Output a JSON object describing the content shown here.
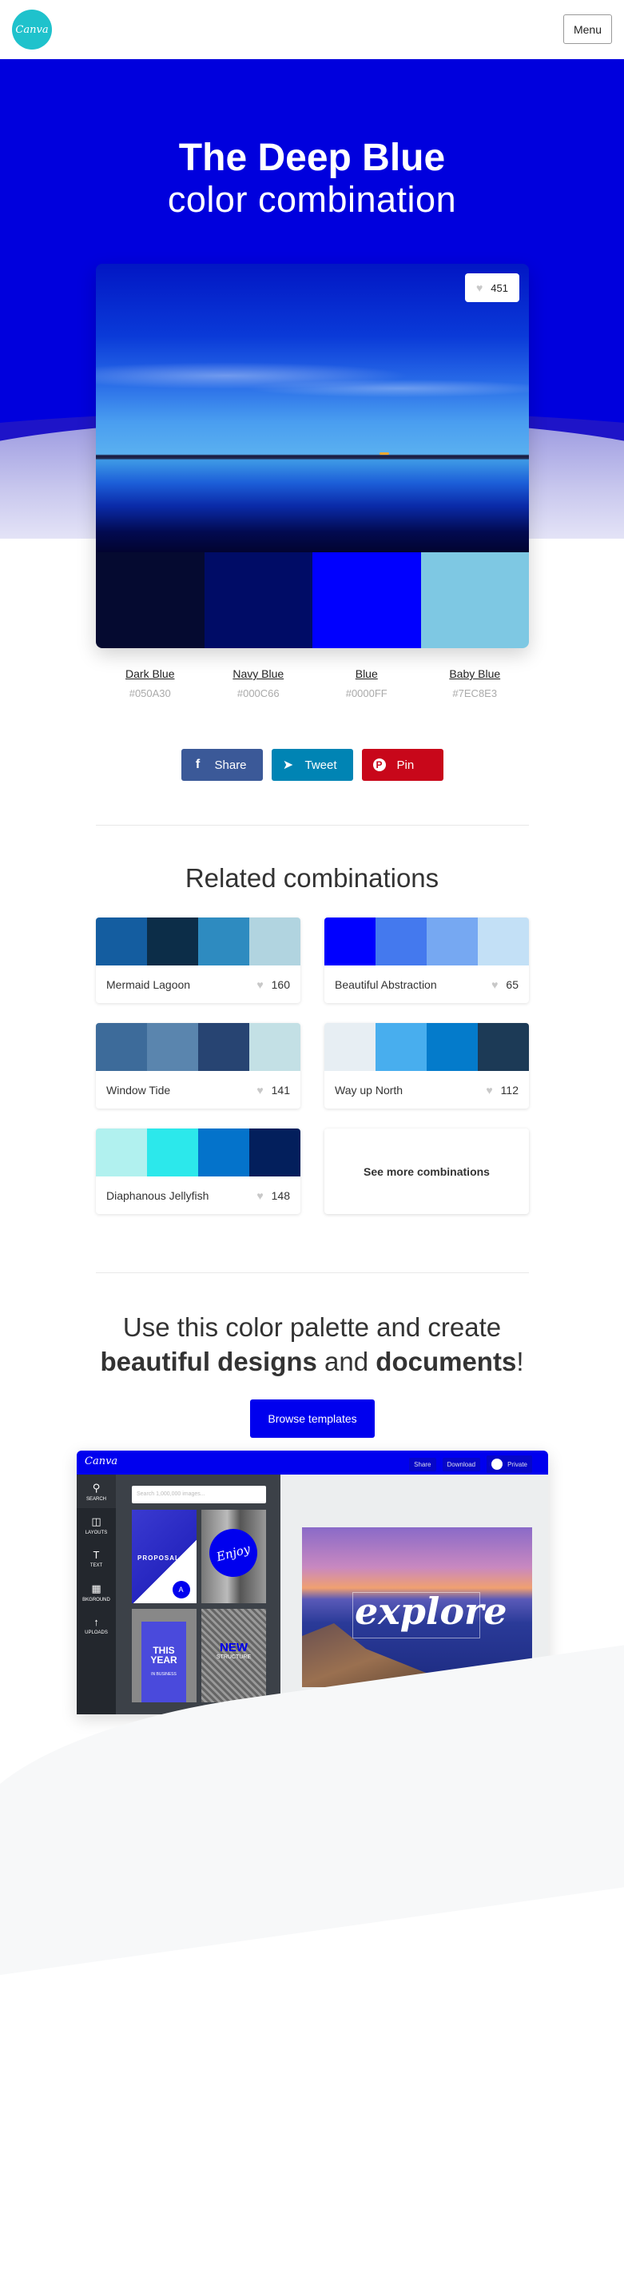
{
  "header": {
    "logo_text": "Canva",
    "menu_label": "Menu"
  },
  "hero": {
    "title": "The Deep Blue",
    "subtitle": "color combination",
    "likes": "451",
    "background_color": "#0000DD"
  },
  "palette": [
    {
      "name": "Dark Blue",
      "hex": "#050A30"
    },
    {
      "name": "Navy Blue",
      "hex": "#000C66"
    },
    {
      "name": "Blue",
      "hex": "#0000FF"
    },
    {
      "name": "Baby Blue",
      "hex": "#7EC8E3"
    }
  ],
  "share": {
    "facebook": {
      "label": "Share",
      "icon": "facebook-icon",
      "color": "#3B5998"
    },
    "twitter": {
      "label": "Tweet",
      "icon": "twitter-icon",
      "color": "#0084B4"
    },
    "pinterest": {
      "label": "Pin",
      "icon": "pinterest-icon",
      "color": "#C8071A"
    }
  },
  "related": {
    "title": "Related combinations",
    "items": [
      {
        "name": "Mermaid Lagoon",
        "likes": "160",
        "colors": [
          "#145DA0",
          "#0C2D48",
          "#2E8BC0",
          "#B1D4E0"
        ]
      },
      {
        "name": "Beautiful Abstraction",
        "likes": "65",
        "colors": [
          "#0000FF",
          "#4479EE",
          "#76A8F2",
          "#C3E0F6"
        ]
      },
      {
        "name": "Window Tide",
        "likes": "141",
        "colors": [
          "#3D6B9A",
          "#5A85AE",
          "#274472",
          "#C3E0E5"
        ]
      },
      {
        "name": "Way up North",
        "likes": "112",
        "colors": [
          "#E7EEF3",
          "#48AEEE",
          "#047BCB",
          "#1C3A56"
        ]
      },
      {
        "name": "Diaphanous Jellyfish",
        "likes": "148",
        "colors": [
          "#B1F1EF",
          "#2CE8EB",
          "#0473CB",
          "#031F5C"
        ]
      }
    ],
    "see_more_label": "See more combinations"
  },
  "cta": {
    "line1": "Use this color palette and create",
    "bold1": "beautiful designs",
    "mid": "and",
    "bold2": "documents",
    "end": "!",
    "button_label": "Browse templates",
    "button_color": "#0000EE"
  },
  "editor_preview": {
    "logo": "Canva",
    "actions": [
      "Share",
      "Download",
      "Private"
    ],
    "tools": [
      "SEARCH",
      "LAYOUTS",
      "TEXT",
      "BKGROUND",
      "UPLOADS"
    ],
    "search_placeholder": "Search 1,000,000 images...",
    "templates": [
      {
        "text": "PROPOSAL",
        "badge": "A"
      },
      {
        "text": "Enjoy"
      },
      {
        "text": "THIS YEAR",
        "sub": "IN BUSINESS"
      },
      {
        "text": "NEW",
        "sub": "STRUCTURE"
      }
    ],
    "canvas_text": "explore"
  }
}
